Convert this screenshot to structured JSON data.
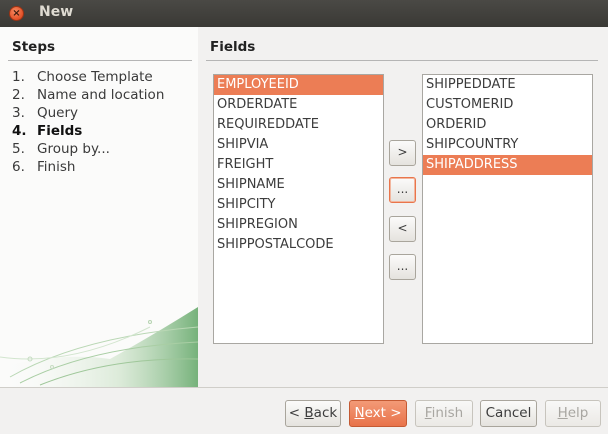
{
  "window": {
    "title": "New",
    "close_glyph": "×"
  },
  "sidebar": {
    "title": "Steps",
    "steps": [
      {
        "num": "1.",
        "label": "Choose Template",
        "active": false
      },
      {
        "num": "2.",
        "label": "Name and location",
        "active": false
      },
      {
        "num": "3.",
        "label": "Query",
        "active": false
      },
      {
        "num": "4.",
        "label": "Fields",
        "active": true
      },
      {
        "num": "5.",
        "label": "Group by...",
        "active": false
      },
      {
        "num": "6.",
        "label": "Finish",
        "active": false
      }
    ]
  },
  "main": {
    "title": "Fields",
    "available_fields": [
      "EMPLOYEEID",
      "ORDERDATE",
      "REQUIREDDATE",
      "SHIPVIA",
      "FREIGHT",
      "SHIPNAME",
      "SHIPCITY",
      "SHIPREGION",
      "SHIPPOSTALCODE"
    ],
    "available_selected": "EMPLOYEEID",
    "selected_fields": [
      "SHIPPEDDATE",
      "CUSTOMERID",
      "ORDERID",
      "SHIPCOUNTRY",
      "SHIPADDRESS"
    ],
    "selected_selected": "SHIPADDRESS",
    "move_buttons": {
      "add": ">",
      "add_all": "...",
      "remove": "<",
      "remove_all": "..."
    }
  },
  "footer": {
    "back": {
      "prefix": "< ",
      "mnemonic": "B",
      "rest": "ack"
    },
    "next": {
      "mnemonic": "N",
      "rest": "ext >"
    },
    "finish": {
      "mnemonic": "F",
      "rest": "inish"
    },
    "cancel": {
      "label": "Cancel"
    },
    "help": {
      "mnemonic": "H",
      "rest": "elp"
    }
  },
  "colors": {
    "accent": "#ec7d55",
    "titlebar": "#3c3b37",
    "sidebar_bg": "#fbfbfa"
  }
}
